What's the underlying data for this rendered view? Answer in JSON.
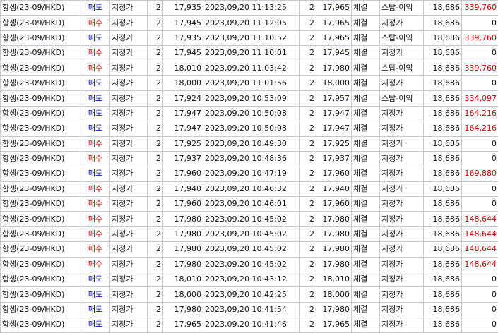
{
  "colors": {
    "sell": "#0000cc",
    "buy": "#dd0000",
    "profit": "#cc0000",
    "grid": "#c9c9d6"
  },
  "rows": [
    {
      "product": "항셍(23-09/HKD)",
      "side": "매도",
      "side_type": "sell",
      "order_type": "지정가",
      "qty": "2",
      "order_price": "17,935",
      "datetime": "2023,09,20 11:13:25",
      "filled_qty": "2",
      "filled_price": "17,965",
      "status": "체결",
      "exec_type": "스탑-이익",
      "price": "18,686",
      "pl": "339,760"
    },
    {
      "product": "항셍(23-09/HKD)",
      "side": "매수",
      "side_type": "buy",
      "order_type": "지정가",
      "qty": "2",
      "order_price": "17,945",
      "datetime": "2023,09,20 11:12:05",
      "filled_qty": "2",
      "filled_price": "17,965",
      "status": "체결",
      "exec_type": "지정가",
      "price": "18,686",
      "pl": "0"
    },
    {
      "product": "항셍(23-09/HKD)",
      "side": "매도",
      "side_type": "sell",
      "order_type": "지정가",
      "qty": "2",
      "order_price": "17,935",
      "datetime": "2023,09,20 11:10:52",
      "filled_qty": "2",
      "filled_price": "17,965",
      "status": "체결",
      "exec_type": "스탑-이익",
      "price": "18,686",
      "pl": "339,760"
    },
    {
      "product": "항셍(23-09/HKD)",
      "side": "매수",
      "side_type": "buy",
      "order_type": "지정가",
      "qty": "2",
      "order_price": "17,945",
      "datetime": "2023,09,20 11:10:01",
      "filled_qty": "2",
      "filled_price": "17,945",
      "status": "체결",
      "exec_type": "지정가",
      "price": "18,686",
      "pl": "0"
    },
    {
      "product": "항셍(23-09/HKD)",
      "side": "매수",
      "side_type": "buy",
      "order_type": "지정가",
      "qty": "2",
      "order_price": "18,010",
      "datetime": "2023,09,20 11:03:42",
      "filled_qty": "2",
      "filled_price": "17,980",
      "status": "체결",
      "exec_type": "스탑-이익",
      "price": "18,686",
      "pl": "339,760"
    },
    {
      "product": "항셍(23-09/HKD)",
      "side": "매도",
      "side_type": "sell",
      "order_type": "지정가",
      "qty": "2",
      "order_price": "18,000",
      "datetime": "2023,09,20 11:01:56",
      "filled_qty": "2",
      "filled_price": "18,000",
      "status": "체결",
      "exec_type": "지정가",
      "price": "18,686",
      "pl": "0"
    },
    {
      "product": "항셍(23-09/HKD)",
      "side": "매도",
      "side_type": "sell",
      "order_type": "지정가",
      "qty": "2",
      "order_price": "17,924",
      "datetime": "2023,09,20 10:53:09",
      "filled_qty": "2",
      "filled_price": "17,957",
      "status": "체결",
      "exec_type": "스탑-이익",
      "price": "18,686",
      "pl": "334,097"
    },
    {
      "product": "항셍(23-09/HKD)",
      "side": "매도",
      "side_type": "sell",
      "order_type": "지정가",
      "qty": "2",
      "order_price": "17,947",
      "datetime": "2023,09,20 10:50:08",
      "filled_qty": "2",
      "filled_price": "17,947",
      "status": "체결",
      "exec_type": "지정가",
      "price": "18,686",
      "pl": "164,216"
    },
    {
      "product": "항셍(23-09/HKD)",
      "side": "매도",
      "side_type": "sell",
      "order_type": "지정가",
      "qty": "2",
      "order_price": "17,947",
      "datetime": "2023,09,20 10:50:08",
      "filled_qty": "2",
      "filled_price": "17,947",
      "status": "체결",
      "exec_type": "지정가",
      "price": "18,686",
      "pl": "164,216"
    },
    {
      "product": "항셍(23-09/HKD)",
      "side": "매수",
      "side_type": "buy",
      "order_type": "지정가",
      "qty": "2",
      "order_price": "17,925",
      "datetime": "2023,09,20 10:49:30",
      "filled_qty": "2",
      "filled_price": "17,925",
      "status": "체결",
      "exec_type": "지정가",
      "price": "18,686",
      "pl": "0"
    },
    {
      "product": "항셍(23-09/HKD)",
      "side": "매수",
      "side_type": "buy",
      "order_type": "지정가",
      "qty": "2",
      "order_price": "17,937",
      "datetime": "2023,09,20 10:48:36",
      "filled_qty": "2",
      "filled_price": "17,937",
      "status": "체결",
      "exec_type": "지정가",
      "price": "18,686",
      "pl": "0"
    },
    {
      "product": "항셍(23-09/HKD)",
      "side": "매도",
      "side_type": "sell",
      "order_type": "지정가",
      "qty": "2",
      "order_price": "17,960",
      "datetime": "2023,09,20 10:47:19",
      "filled_qty": "2",
      "filled_price": "17,960",
      "status": "체결",
      "exec_type": "지정가",
      "price": "18,686",
      "pl": "169,880"
    },
    {
      "product": "항셍(23-09/HKD)",
      "side": "매수",
      "side_type": "buy",
      "order_type": "지정가",
      "qty": "2",
      "order_price": "17,940",
      "datetime": "2023,09,20 10:46:32",
      "filled_qty": "2",
      "filled_price": "17,940",
      "status": "체결",
      "exec_type": "지정가",
      "price": "18,686",
      "pl": "0"
    },
    {
      "product": "항셍(23-09/HKD)",
      "side": "매수",
      "side_type": "buy",
      "order_type": "지정가",
      "qty": "2",
      "order_price": "17,960",
      "datetime": "2023,09,20 10:46:01",
      "filled_qty": "2",
      "filled_price": "17,960",
      "status": "체결",
      "exec_type": "지정가",
      "price": "18,686",
      "pl": "0"
    },
    {
      "product": "항셍(23-09/HKD)",
      "side": "매수",
      "side_type": "buy",
      "order_type": "지정가",
      "qty": "2",
      "order_price": "17,980",
      "datetime": "2023,09,20 10:45:02",
      "filled_qty": "2",
      "filled_price": "17,980",
      "status": "체결",
      "exec_type": "지정가",
      "price": "18,686",
      "pl": "148,644"
    },
    {
      "product": "항셍(23-09/HKD)",
      "side": "매수",
      "side_type": "buy",
      "order_type": "지정가",
      "qty": "2",
      "order_price": "17,980",
      "datetime": "2023,09,20 10:45:02",
      "filled_qty": "2",
      "filled_price": "17,980",
      "status": "체결",
      "exec_type": "지정가",
      "price": "18,686",
      "pl": "148,644"
    },
    {
      "product": "항셍(23-09/HKD)",
      "side": "매수",
      "side_type": "buy",
      "order_type": "지정가",
      "qty": "2",
      "order_price": "17,980",
      "datetime": "2023,09,20 10:45:02",
      "filled_qty": "2",
      "filled_price": "17,980",
      "status": "체결",
      "exec_type": "지정가",
      "price": "18,686",
      "pl": "148,644"
    },
    {
      "product": "항셍(23-09/HKD)",
      "side": "매수",
      "side_type": "buy",
      "order_type": "지정가",
      "qty": "2",
      "order_price": "17,980",
      "datetime": "2023,09,20 10:45:02",
      "filled_qty": "2",
      "filled_price": "17,980",
      "status": "체결",
      "exec_type": "지정가",
      "price": "18,686",
      "pl": "148,644"
    },
    {
      "product": "항셍(23-09/HKD)",
      "side": "매도",
      "side_type": "sell",
      "order_type": "지정가",
      "qty": "2",
      "order_price": "18,010",
      "datetime": "2023,09,20 10:43:12",
      "filled_qty": "2",
      "filled_price": "18,010",
      "status": "체결",
      "exec_type": "지정가",
      "price": "18,686",
      "pl": "0"
    },
    {
      "product": "항셍(23-09/HKD)",
      "side": "매도",
      "side_type": "sell",
      "order_type": "지정가",
      "qty": "2",
      "order_price": "18,000",
      "datetime": "2023,09,20 10:42:25",
      "filled_qty": "2",
      "filled_price": "18,000",
      "status": "체결",
      "exec_type": "지정가",
      "price": "18,686",
      "pl": "0"
    },
    {
      "product": "항셍(23-09/HKD)",
      "side": "매도",
      "side_type": "sell",
      "order_type": "지정가",
      "qty": "2",
      "order_price": "17,980",
      "datetime": "2023,09,20 10:41:54",
      "filled_qty": "2",
      "filled_price": "17,980",
      "status": "체결",
      "exec_type": "지정가",
      "price": "18,686",
      "pl": "0"
    },
    {
      "product": "항셍(23-09/HKD)",
      "side": "매도",
      "side_type": "sell",
      "order_type": "지정가",
      "qty": "2",
      "order_price": "17,965",
      "datetime": "2023,09,20 10:41:46",
      "filled_qty": "2",
      "filled_price": "17,965",
      "status": "체결",
      "exec_type": "지정가",
      "price": "18,686",
      "pl": "0"
    }
  ]
}
